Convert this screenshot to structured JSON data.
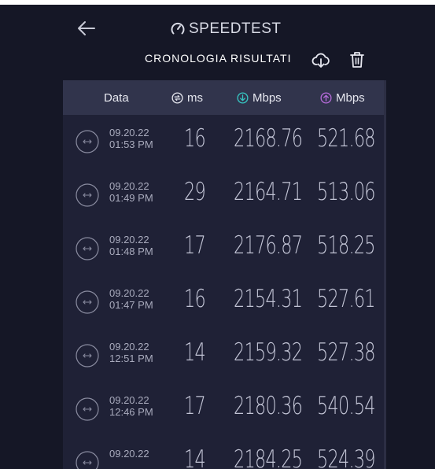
{
  "app": {
    "logo_text": "SPEEDTEST"
  },
  "header": {
    "title": "CRONOLOGIA RISULTATI"
  },
  "table": {
    "columns": {
      "date": "Data",
      "ping": "ms",
      "download": "Mbps",
      "upload": "Mbps"
    },
    "rows": [
      {
        "date": "09.20.22",
        "time": "01:53 PM",
        "ping": "16",
        "download": "2168.76",
        "upload": "521.68"
      },
      {
        "date": "09.20.22",
        "time": "01:49 PM",
        "ping": "29",
        "download": "2164.71",
        "upload": "513.06"
      },
      {
        "date": "09.20.22",
        "time": "01:48 PM",
        "ping": "17",
        "download": "2176.87",
        "upload": "518.25"
      },
      {
        "date": "09.20.22",
        "time": "01:47 PM",
        "ping": "16",
        "download": "2154.31",
        "upload": "527.61"
      },
      {
        "date": "09.20.22",
        "time": "12:51 PM",
        "ping": "14",
        "download": "2159.32",
        "upload": "527.38"
      },
      {
        "date": "09.20.22",
        "time": "12:46 PM",
        "ping": "17",
        "download": "2180.36",
        "upload": "540.54"
      },
      {
        "date": "09.20.22",
        "time": "",
        "ping": "14",
        "download": "2184.25",
        "upload": "524.39"
      }
    ]
  },
  "colors": {
    "background": "#151726",
    "panel": "#1f2136",
    "header_row": "#31344c",
    "download_accent": "#36c6c2",
    "upload_accent": "#b56bd9"
  }
}
